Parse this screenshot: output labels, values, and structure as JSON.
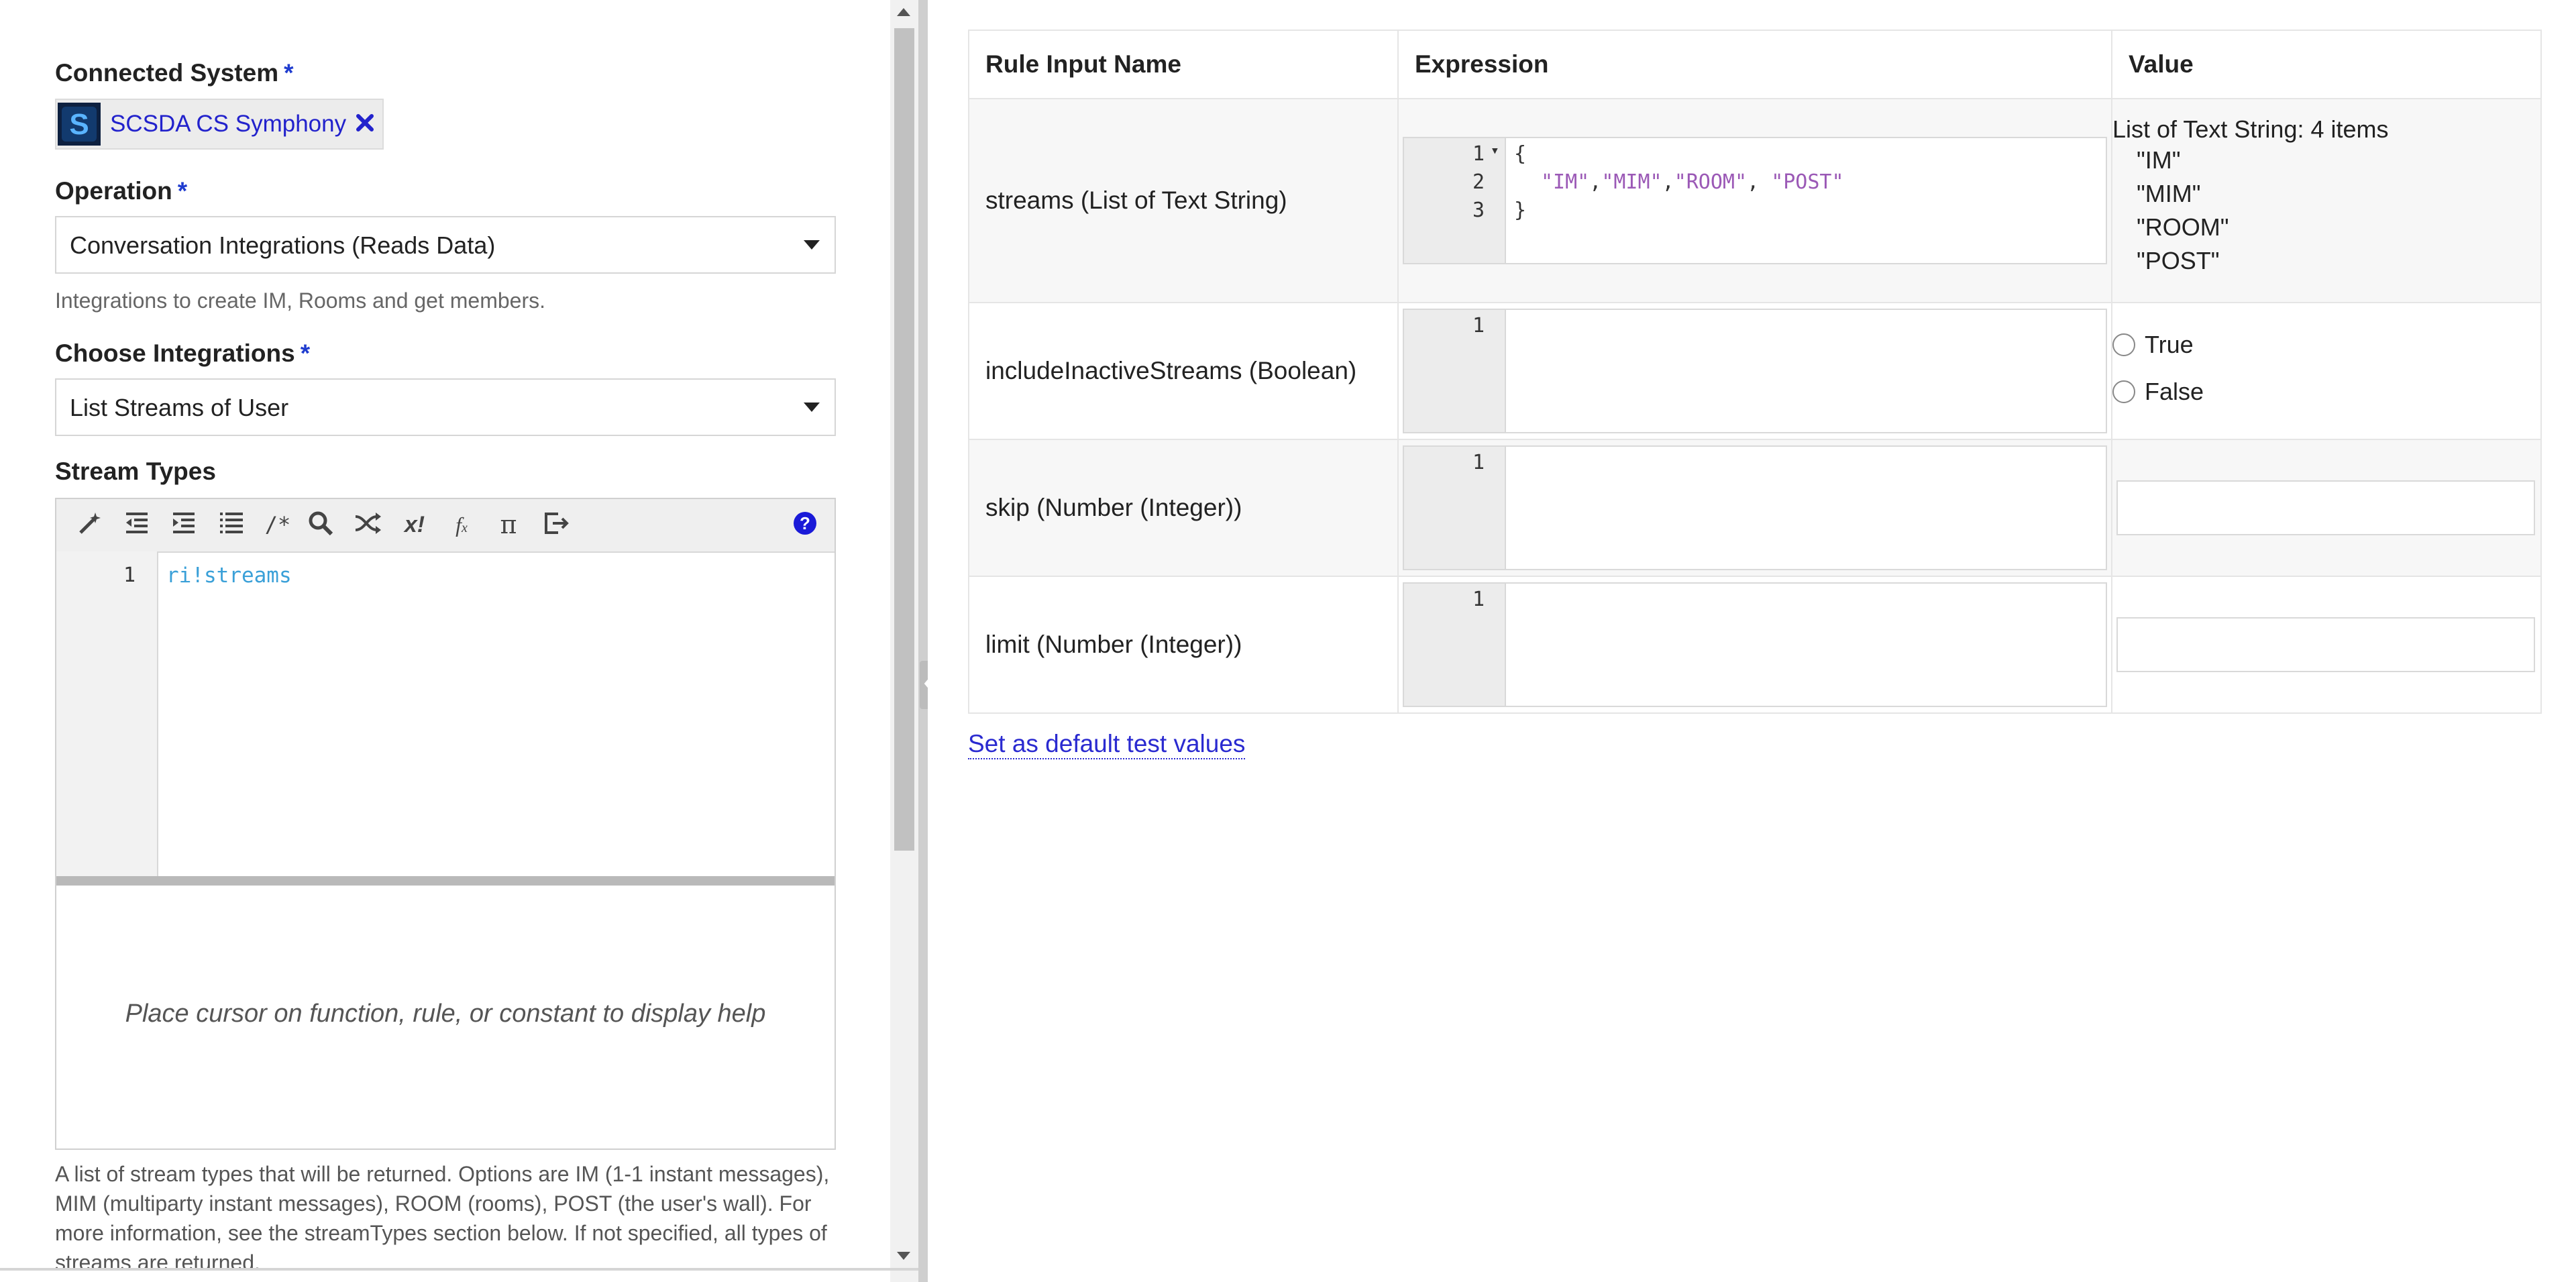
{
  "left": {
    "connected_system": {
      "label": "Connected System",
      "required_mark": "*",
      "chip_label": "SCSDA CS Symphony",
      "chip_logo_letter": "S"
    },
    "operation": {
      "label": "Operation",
      "required_mark": "*",
      "value": "Conversation Integrations (Reads Data)",
      "help": "Integrations to create IM, Rooms and get members."
    },
    "choose_integrations": {
      "label": "Choose Integrations",
      "required_mark": "*",
      "value": "List Streams of User"
    },
    "stream_types": {
      "label": "Stream Types",
      "line_number": "1",
      "code": "ri!streams",
      "help_placeholder": "Place cursor on function, rule, or constant to display help",
      "description": "A list of stream types that will be returned. Options are IM (1-1 instant messages), MIM (multiparty instant messages), ROOM (rooms), POST (the user's wall). For more information, see the streamTypes section below. If not specified, all types of streams are returned."
    },
    "toolbar_icons": [
      "wand-icon",
      "outdent-icon",
      "indent-icon",
      "list-icon",
      "comment-icon",
      "search-icon",
      "shuffle-icon",
      "factorial-icon",
      "function-icon",
      "pi-icon",
      "export-icon",
      "help-icon"
    ]
  },
  "table": {
    "headers": {
      "name": "Rule Input Name",
      "expression": "Expression",
      "value": "Value"
    },
    "rows": [
      {
        "name": "streams (List of Text String)",
        "lines": [
          "1",
          "2",
          "3"
        ],
        "fold_marker": "▾",
        "code_open": "{",
        "code_strings": [
          "\"IM\"",
          "\"MIM\"",
          "\"ROOM\"",
          "\"POST\""
        ],
        "code_close": "}",
        "value_header": "List of Text String: 4 items",
        "value_items": [
          "\"IM\"",
          "\"MIM\"",
          "\"ROOM\"",
          "\"POST\""
        ]
      },
      {
        "name": "includeInactiveStreams (Boolean)",
        "lines": [
          "1"
        ],
        "options": [
          "True",
          "False"
        ]
      },
      {
        "name": "skip (Number (Integer))",
        "lines": [
          "1"
        ]
      },
      {
        "name": "limit (Number (Integer))",
        "lines": [
          "1"
        ]
      }
    ]
  },
  "default_link": "Set as default test values",
  "colors": {
    "link": "#2a2ad0",
    "required": "#1f3ccf",
    "code_ref": "#3aa0d8",
    "code_string": "#9b59b6",
    "help_icon": "#1a1ad8"
  }
}
